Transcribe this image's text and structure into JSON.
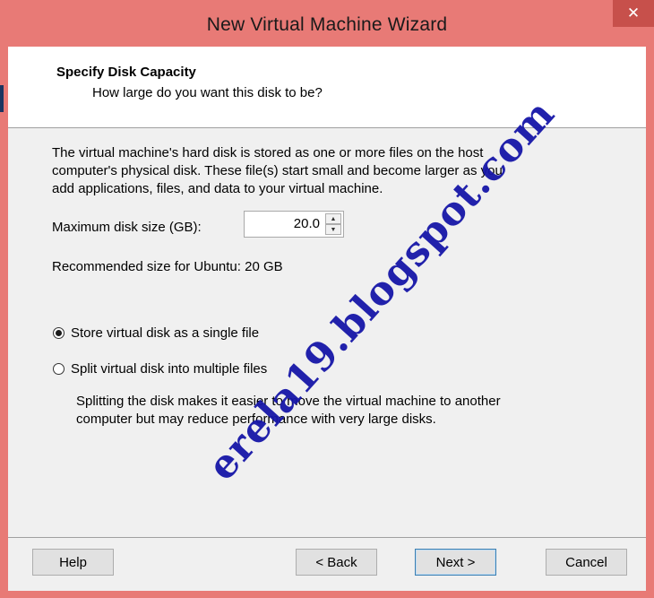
{
  "window": {
    "title": "New Virtual Machine Wizard",
    "close_glyph": "✕"
  },
  "header": {
    "title": "Specify Disk Capacity",
    "subtitle": "How large do you want this disk to be?"
  },
  "body": {
    "description": "The virtual machine's hard disk is stored as one or more files on the host\ncomputer's physical disk. These file(s) start small and become larger as you\nadd applications, files, and data to your virtual machine.",
    "max_size_label": "Maximum disk size (GB):",
    "max_size_value": "20.0",
    "recommended": "Recommended size for Ubuntu: 20 GB",
    "radio_single": "Store virtual disk as a single file",
    "radio_single_checked": true,
    "radio_split": "Split virtual disk into multiple files",
    "radio_split_checked": false,
    "split_note": "Splitting the disk makes it easier to move the virtual machine to another\ncomputer but may reduce performance with very large disks."
  },
  "buttons": {
    "help": "Help",
    "back": "< Back",
    "next": "Next >",
    "cancel": "Cancel"
  },
  "watermark": "erela19.blogspot.com",
  "colors": {
    "titlebar": "#e87a76",
    "close_button": "#c7504b",
    "client_bg": "#f0f0f0",
    "watermark": "#1616a8"
  }
}
